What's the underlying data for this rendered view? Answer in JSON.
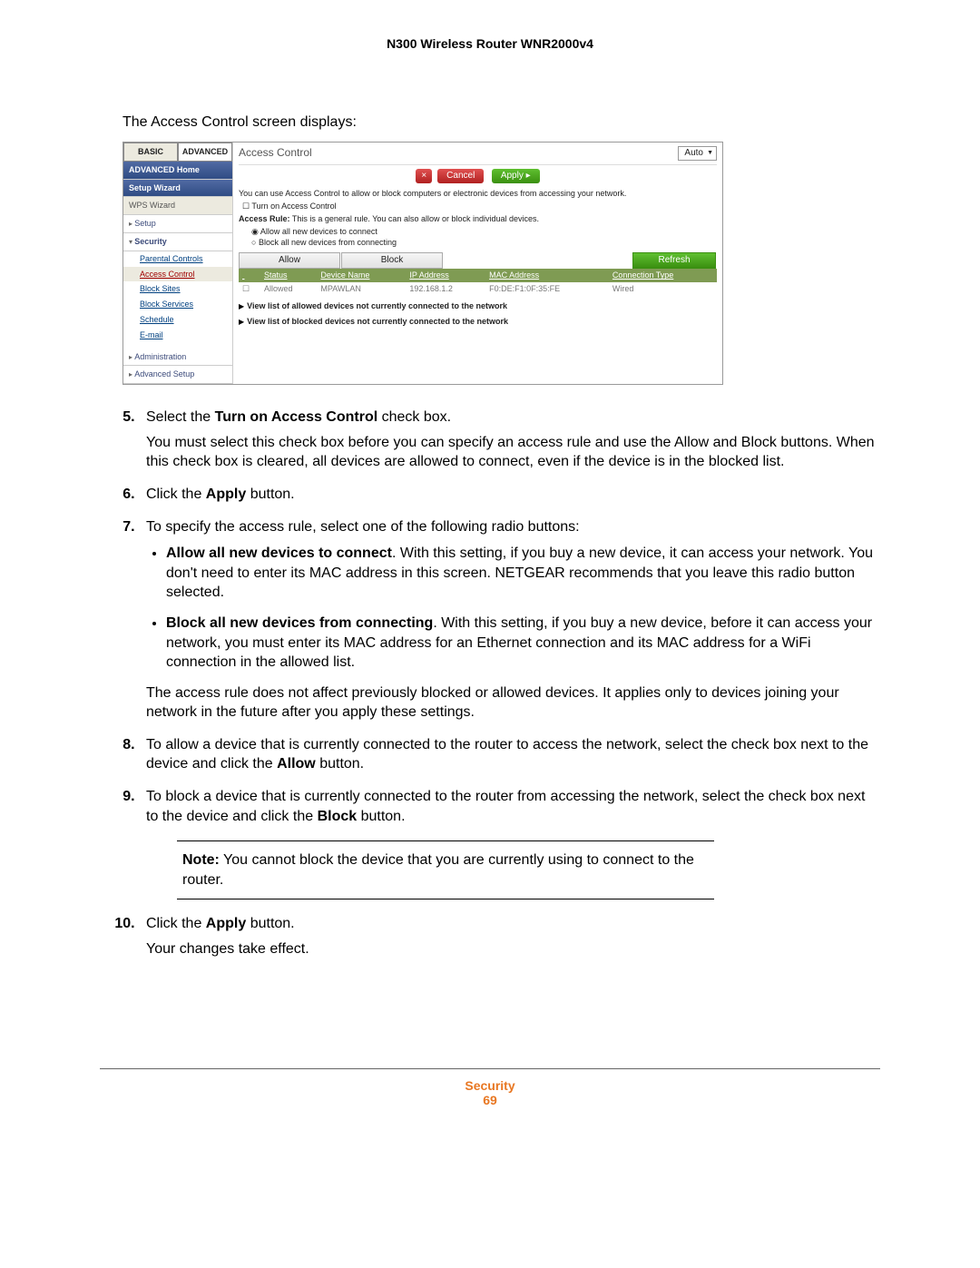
{
  "header": {
    "title": "N300 Wireless Router WNR2000v4"
  },
  "intro": "The Access Control screen displays:",
  "screenshot": {
    "tabs": {
      "basic": "BASIC",
      "advanced": "ADVANCED"
    },
    "dropdown_value": "Auto",
    "nav": {
      "adv_home": "ADVANCED Home",
      "setup_wizard": "Setup Wizard",
      "wps_wizard": "WPS Wizard",
      "setup": "Setup",
      "security": "Security",
      "security_items": {
        "parental": "Parental Controls",
        "access_control": "Access Control",
        "block_sites": "Block Sites",
        "block_services": "Block Services",
        "schedule": "Schedule",
        "email": "E-mail"
      },
      "administration": "Administration",
      "advanced_setup": "Advanced Setup"
    },
    "panel": {
      "title": "Access Control",
      "buttons": {
        "x": "×",
        "cancel": "Cancel",
        "apply": "Apply"
      },
      "line_use": "You can use Access Control to allow or block computers or electronic devices from accessing your network.",
      "chk_turn_on": "Turn on Access Control",
      "rule_label_prefix": "Access Rule:",
      "rule_label_rest": " This is a general rule. You can also allow or block individual devices.",
      "radio_allow": "Allow all new devices to connect",
      "radio_block": "Block all new devices from connecting",
      "btn_allow": "Allow",
      "btn_block": "Block",
      "btn_refresh": "Refresh",
      "th": {
        "status": "Status",
        "device": "Device Name",
        "ip": "IP Address",
        "mac": "MAC Address",
        "conn": "Connection Type"
      },
      "row": {
        "status": "Allowed",
        "device": "MPAWLAN",
        "ip": "192.168.1.2",
        "mac": "F0:DE:F1:0F:35:FE",
        "conn": "Wired"
      },
      "view_allowed": "View list of allowed devices not currently connected to the network",
      "view_blocked": "View list of blocked devices not currently connected to the network"
    }
  },
  "steps": {
    "s5_prefix": "Select the ",
    "s5_bold": "Turn on Access Control",
    "s5_suffix": " check box.",
    "s5_para": "You must select this check box before you can specify an access rule and use the Allow and Block buttons. When this check box is cleared, all devices are allowed to connect, even if the device is in the blocked list.",
    "s6_prefix": "Click the ",
    "s6_bold": "Apply",
    "s6_suffix": " button.",
    "s7_line": "To specify the access rule, select one of the following radio buttons:",
    "s7_b1_bold": "Allow all new devices to connect",
    "s7_b1_rest": ". With this setting, if you buy a new device, it can access your network. You don't need to enter its MAC address in this screen. NETGEAR recommends that you leave this radio button selected.",
    "s7_b2_bold": "Block all new devices from connecting",
    "s7_b2_rest": ". With this setting, if you buy a new device, before it can access your network, you must enter its MAC address for an Ethernet connection and its MAC address for a WiFi connection in the allowed list.",
    "s7_tail": "The access rule does not affect previously blocked or allowed devices. It applies only to devices joining your network in the future after you apply these settings.",
    "s8_a": "To allow a device that is currently connected to the router to access the network, select the check box next to the device and click the ",
    "s8_bold": "Allow",
    "s8_b": " button.",
    "s9_a": "To block a device that is currently connected to the router from accessing the network, select the check box next to the device and click the ",
    "s9_bold": "Block",
    "s9_b": " button.",
    "note_bold": "Note:",
    "note_rest": " You cannot block the device that you are currently using to connect to the router.",
    "s10_prefix": "Click the ",
    "s10_bold": "Apply",
    "s10_suffix": " button.",
    "s10_para": "Your changes take effect."
  },
  "footer": {
    "category": "Security",
    "page": "69"
  }
}
